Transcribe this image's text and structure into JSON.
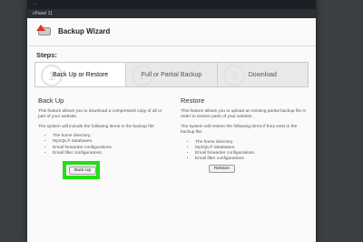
{
  "topbar": {
    "text": "..."
  },
  "header": {
    "crumb": "cPanel 11"
  },
  "title": "Backup Wizard",
  "steps_label": "Steps:",
  "steps": [
    {
      "number": "1",
      "label": "Back Up or Restore",
      "active": true
    },
    {
      "number": "2",
      "label": "Full or Partial Backup",
      "active": false
    },
    {
      "number": "3",
      "label": "Download",
      "active": false
    }
  ],
  "backup": {
    "heading": "Back Up",
    "desc": "This feature allows you to download a compressed copy of all or part of your website.",
    "include_text": "The system will include the following items in the backup file:",
    "items": [
      "The home directory.",
      "MySQL® databases.",
      "Email forwarder configurations.",
      "Email filter configurations."
    ],
    "button": "Back Up"
  },
  "restore": {
    "heading": "Restore",
    "desc": "This feature allows you to upload an existing partial backup file in order to restore parts of your website.",
    "include_text": "The system will restore the following items if they exist in the backup file:",
    "items": [
      "The home directory.",
      "MySQL® databases.",
      "Email forwarder configurations.",
      "Email filter configurations."
    ],
    "button": "Restore"
  },
  "colors": {
    "highlight": "#22e010",
    "background": "#3b3e42"
  }
}
